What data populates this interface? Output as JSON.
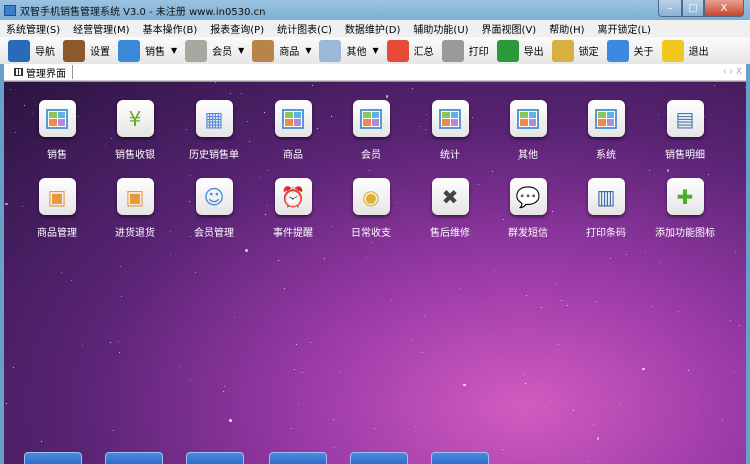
{
  "window": {
    "title": "双智手机销售管理系统 V3.0  - 未注册 www.in0530.cn",
    "min": "–",
    "max": "□",
    "close": "X"
  },
  "menu": [
    "系统管理(S)",
    "经营管理(M)",
    "基本操作(B)",
    "报表查询(P)",
    "统计图表(C)",
    "数据维护(D)",
    "辅助功能(U)",
    "界面视图(V)",
    "帮助(H)",
    "离开锁定(L)"
  ],
  "toolbar": [
    {
      "label": "导航",
      "icon": "monitor-icon",
      "color": "#2a6ab8",
      "dropdown": false
    },
    {
      "label": "设置",
      "icon": "address-book-icon",
      "color": "#8a5a2a",
      "dropdown": false
    },
    {
      "label": "销售",
      "icon": "store-icon",
      "color": "#3a8ad8",
      "dropdown": true
    },
    {
      "label": "会员",
      "icon": "card-icon",
      "color": "#a8a8a0",
      "dropdown": true
    },
    {
      "label": "商品",
      "icon": "box-icon",
      "color": "#b8844a",
      "dropdown": true
    },
    {
      "label": "其他",
      "icon": "calculator-icon",
      "color": "#9ab8d8",
      "dropdown": true
    },
    {
      "label": "汇总",
      "icon": "pie-chart-icon",
      "color": "#e84a3a",
      "dropdown": false
    },
    {
      "label": "打印",
      "icon": "printer-icon",
      "color": "#9a9a9a",
      "dropdown": false
    },
    {
      "label": "导出",
      "icon": "excel-icon",
      "color": "#2a9a3a",
      "dropdown": false
    },
    {
      "label": "锁定",
      "icon": "lock-icon",
      "color": "#d8b040",
      "dropdown": false
    },
    {
      "label": "关于",
      "icon": "computer-icon",
      "color": "#3a8ae0",
      "dropdown": false
    },
    {
      "label": "退出",
      "icon": "exit-sign-icon",
      "color": "#f0c820",
      "dropdown": false
    }
  ],
  "tab": {
    "label": "管理界面",
    "nav": "‹ › X"
  },
  "tiles": [
    {
      "label": "销售",
      "icon": "grid",
      "glyph": ""
    },
    {
      "label": "销售收银",
      "icon": "yen",
      "glyph": "¥"
    },
    {
      "label": "历史销售单",
      "icon": "calendar",
      "glyph": "▦"
    },
    {
      "label": "商品",
      "icon": "grid",
      "glyph": ""
    },
    {
      "label": "会员",
      "icon": "grid",
      "glyph": ""
    },
    {
      "label": "统计",
      "icon": "grid",
      "glyph": ""
    },
    {
      "label": "其他",
      "icon": "grid",
      "glyph": ""
    },
    {
      "label": "系统",
      "icon": "grid",
      "glyph": ""
    },
    {
      "label": "销售明细",
      "icon": "table",
      "glyph": "▤"
    },
    {
      "label": "商品管理",
      "icon": "boxes",
      "glyph": "▣"
    },
    {
      "label": "进货退货",
      "icon": "boxes",
      "glyph": "▣"
    },
    {
      "label": "会员管理",
      "icon": "id-card",
      "glyph": "☺"
    },
    {
      "label": "事件提醒",
      "icon": "clock",
      "glyph": "⏰"
    },
    {
      "label": "日常收支",
      "icon": "coins",
      "glyph": "◉"
    },
    {
      "label": "售后维修",
      "icon": "tools",
      "glyph": "✖"
    },
    {
      "label": "群发短信",
      "icon": "chat",
      "glyph": "💬"
    },
    {
      "label": "打印条码",
      "icon": "barcode",
      "glyph": "▥"
    },
    {
      "label": "添加功能图标",
      "icon": "plus",
      "glyph": "✚"
    }
  ]
}
